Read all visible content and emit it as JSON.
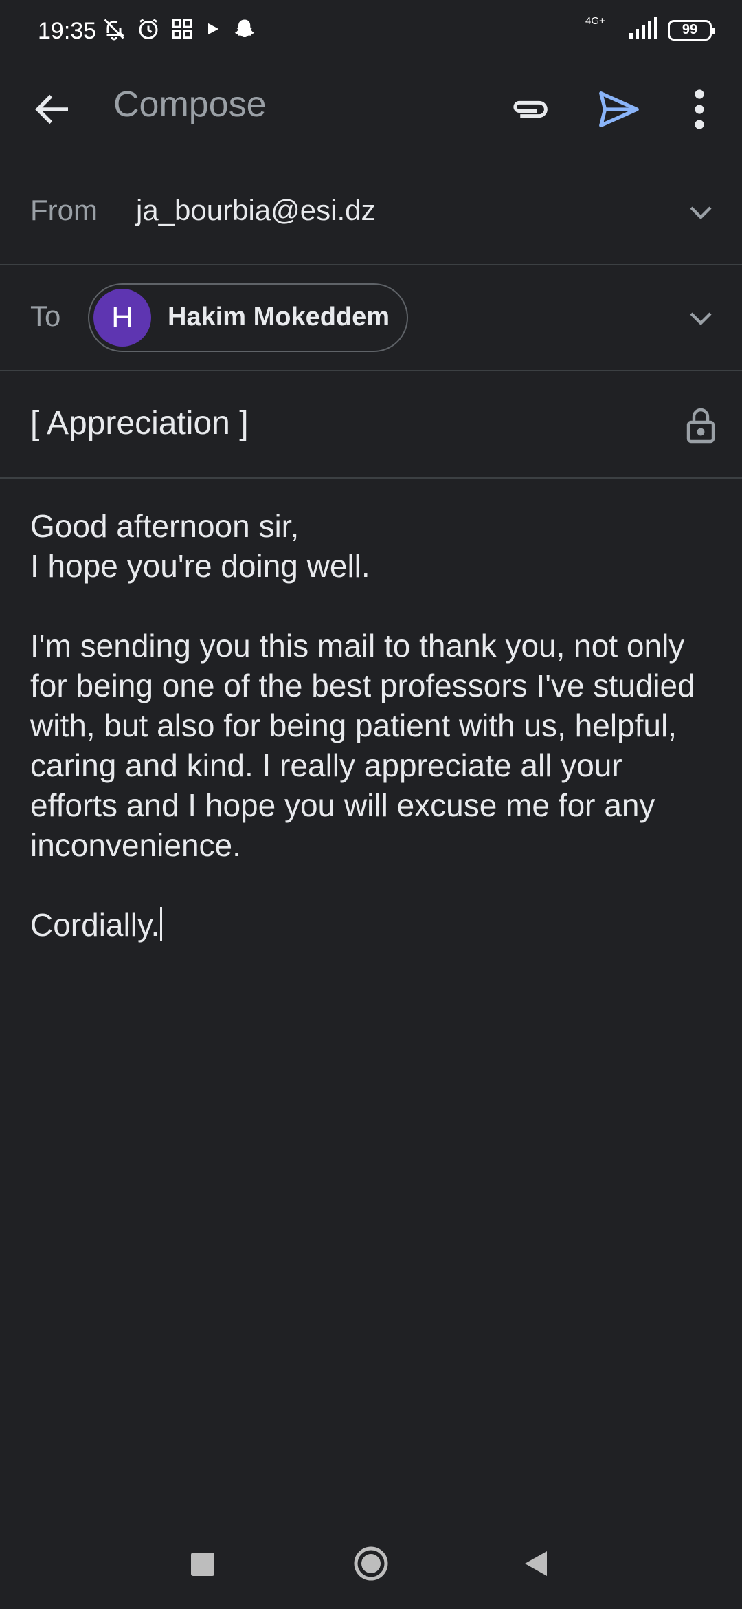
{
  "status_bar": {
    "time": "19:35",
    "network": "4G+",
    "battery": "99",
    "icons": [
      "bell-off-icon",
      "alarm-icon",
      "qr-grid-icon",
      "play-icon",
      "snapchat-icon",
      "signal-icon",
      "battery-icon"
    ]
  },
  "toolbar": {
    "title": "Compose",
    "icons": [
      "arrow-back-icon",
      "attach-icon",
      "send-icon",
      "more-vert-icon"
    ],
    "send_color": "#8ab4f8"
  },
  "from": {
    "label": "From",
    "value": "ja_bourbia@esi.dz"
  },
  "to": {
    "label": "To",
    "recipient": {
      "initial": "H",
      "name": "Hakim Mokeddem",
      "avatar_color": "#5e35b1"
    }
  },
  "subject": {
    "value": "[ Appreciation ]"
  },
  "body": {
    "line1": "Good afternoon sir,",
    "line2": "I hope you're doing well.",
    "paragraph": "I'm sending you this mail to thank you, not only for being one of the best professors I've studied with, but also for being patient with us, helpful, caring and kind. I really appreciate all your efforts and I hope you will excuse me for any inconvenience.",
    "closing": "Cordially."
  },
  "nav_bar": {
    "icons": [
      "recents-square-icon",
      "home-circle-icon",
      "back-triangle-icon"
    ]
  }
}
